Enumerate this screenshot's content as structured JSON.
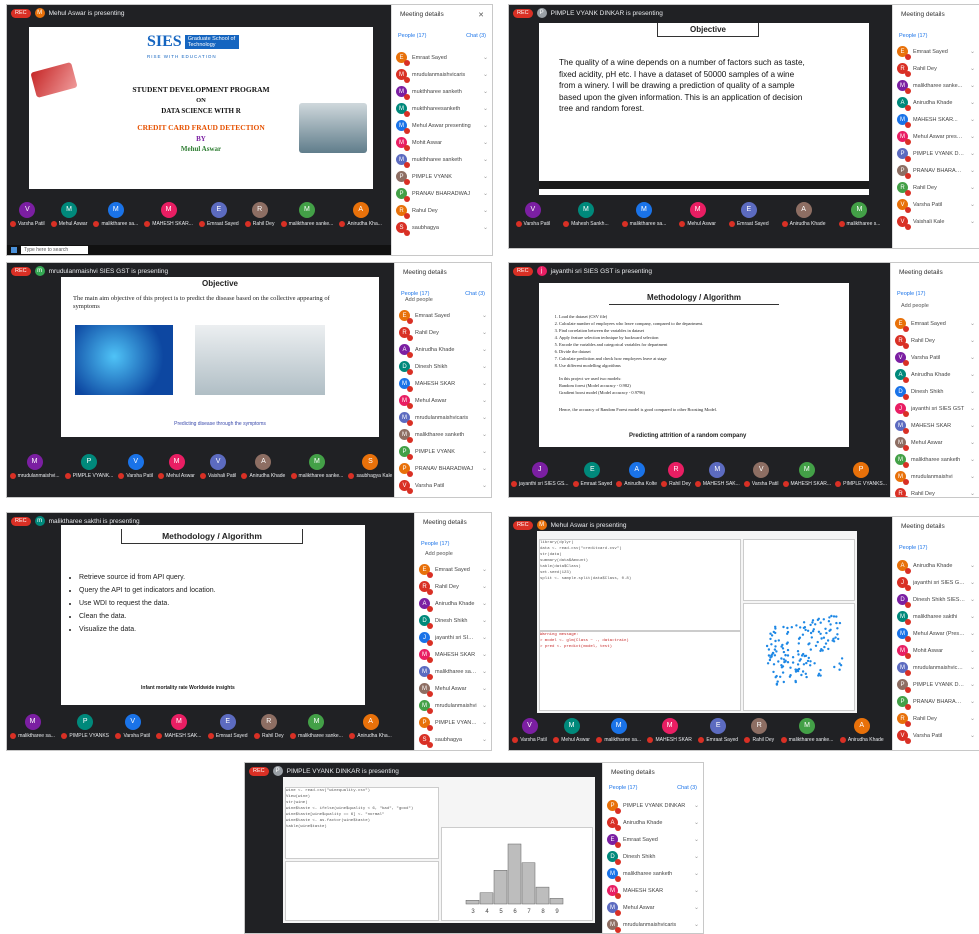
{
  "colors": {
    "meet_bg": "#202124",
    "accent": "#1a73e8",
    "mute": "#d93025",
    "rec": "#d93025"
  },
  "panel_common": {
    "title": "Meeting details",
    "people_tab": "People (17)",
    "chat_tab": "Chat (3)",
    "add_people": "Add people"
  },
  "shot1": {
    "presenter": "Mehul Aswar is presenting",
    "rec": "REC",
    "logo_text": "SIES",
    "logo_sub": "Graduate School of Technology",
    "logo_tagline": "RISE WITH EDUCATION",
    "line1": "STUDENT DEVELOPMENT PROGRAM",
    "line2": "ON",
    "line3": "DATA SCIENCE WITH R",
    "line4": "CREDIT CARD FRAUD DETECTION",
    "line5": "BY",
    "line6": "Mehul Aswar",
    "participants": [
      "Emraat Sayed",
      "mrudulanmaishvicaris",
      "mukthharee sanketh",
      "mukthhareesanketh",
      "Mehul Aswar presenting",
      "Mohit Aswar",
      "mukthharee sanketh",
      "PIMPLE VYANK",
      "PRANAV BHARADWAJ",
      "Rahul Dey",
      "saubhagya"
    ],
    "tiles": [
      "Varsha Patil",
      "Mehul Aswar",
      "maliktharee sa...",
      "MAHESH SKAR...",
      "Emraat Sayed",
      "Rahil Dey",
      "maliktharee sanke...",
      "Anirudha Kha..."
    ],
    "search": "Type here to search"
  },
  "shot2": {
    "presenter": "PIMPLE VYANK DINKAR is presenting",
    "slide_title": "Objective",
    "slide_body": "The quality of a wine depends on a number of factors such as taste, fixed acidity, pH etc. I have a dataset of 50000 samples of a wine from a winery. I will be drawing a prediction of quality of a sample based upon the given information. This is an application of decision tree and random forest.",
    "participants": [
      "Emraat Sayed",
      "Rahil Dey",
      "maliktharee sanke...",
      "Anirudha Khade",
      "MAHESH SKAR...",
      "Mehul Aswar presenting",
      "PIMPLE VYANK DINKAR",
      "PRANAV BHARADWAJ",
      "Rahil Dey",
      "Varsha Patil",
      "Vaishali Kale"
    ],
    "tiles": [
      "Varsha Patil",
      "Mahesh Sankh...",
      "maliktharee sa...",
      "Mehul Aswar",
      "Emraat Sayed",
      "Anirudha Khade",
      "maliktharee s..."
    ]
  },
  "shot3": {
    "presenter": "mrudulanmaishvi SIES GST is presenting",
    "slide_title": "Objective",
    "bullet": "The main aim objective of this project is to predict the disease based on the collective appearing of symptoms",
    "footer": "Predicting disease through the symptoms",
    "participants": [
      "Emraat Sayed",
      "Rahil Dey",
      "Anirudha Khade",
      "Dinesh Shikh",
      "MAHESH SKAR",
      "Mehul Aswar",
      "mrudulanmaishvicaris",
      "maliktharee sanketh",
      "PIMPLE VYANK",
      "PRANAV BHARADWAJ",
      "Varsha Patil"
    ],
    "tiles": [
      "mrudulanmaishvi...",
      "PIMPLE VYANK...",
      "Varsha Patil",
      "Mehul Aswar",
      "Vaishali Patil",
      "Anirudha Khade",
      "maliktharee sanke...",
      "saubhagya Kale"
    ]
  },
  "shot4": {
    "presenter": "jayanthi sri SIES GST is presenting",
    "slide_title": "Methodology / Algorithm",
    "steps": [
      "Load the dataset (CSV file)",
      "Calculate number of employees who leave company, compared to the department.",
      "Find correlation between the variables in dataset",
      "Apply feature selection technique by backward selection",
      "Encode the variables and categorical variables for department",
      "Divide the dataset",
      "Calculate prediction and check how employees leave at stage",
      "Use different modelling algorithms"
    ],
    "conclusion_lines": [
      "In this project we used two models:",
      "Random forest (Model accuracy - 0.982)",
      "Gradient boost model (Model accuracy - 0.9796)"
    ],
    "final": "Hence, the accuracy of Random Forest model is good compared to other Boosting Model.",
    "footer": "Predicting attrition of a random company",
    "participants": [
      "Emraat Sayed",
      "Rahil Dey",
      "Varsha Patil",
      "Anirudha Khade",
      "Dinesh Shikh",
      "jayanthi sri SIES GST",
      "MAHESH SKAR",
      "Mehul Aswar",
      "maliktharee sanketh",
      "mrudulanmaishvi",
      "Rahil Dey"
    ],
    "tiles": [
      "jayanthi sri SIES GS...",
      "Emraat Sayed",
      "Anirudha Kolte",
      "Rahil Dey",
      "MAHESH SAK...",
      "Varsha Patil",
      "MAHESH SKAR...",
      "PIMPLE VYANKS..."
    ]
  },
  "shot5": {
    "presenter": "maliktharee sakthi is presenting",
    "slide_title": "Methodology / Algorithm",
    "bullets": [
      "Retrieve source id from API query.",
      "Query the API to get indicators and location.",
      "Use WDI to request the data.",
      "Clean the data.",
      "Visualize the data."
    ],
    "footer": "Infant mortality rate Worldwide insights",
    "participants": [
      "Emraat Sayed",
      "Rahil Dey",
      "Anirudha Khade",
      "Dinesh Shikh",
      "jayanthi sri SIES GST",
      "MAHESH SKAR",
      "maliktharee sakthi",
      "Mehul Aswar",
      "mrudulanmaishvi",
      "PIMPLE VYANKS",
      "saubhagya"
    ],
    "tiles": [
      "maliktharee sa...",
      "PIMPLE VYANKS",
      "Varsha Patil",
      "MAHESH SAK...",
      "Emraat Sayed",
      "Rahil Dey",
      "maliktharee sanke...",
      "Anirudha Kha..."
    ]
  },
  "shot6": {
    "presenter": "Mehul Aswar is presenting",
    "participants": [
      "Anirudha Khade",
      "jayanthi sri SIES GST",
      "Dinesh Shikh SIES GST",
      "maliktharee sakthi",
      "Mehul Aswar (Presenting)",
      "Mohit Aswar",
      "mrudulanmaishvicaris",
      "PIMPLE VYANK DINKAR",
      "PRANAV BHARADWAJ",
      "Rahil Dey",
      "Varsha Patil"
    ],
    "tiles": [
      "Varsha Patil",
      "Mehul Aswar",
      "maliktharee sa...",
      "MAHESH SKAR",
      "Emraat Sayed",
      "Rahil Dey",
      "maliktharee sanke...",
      "Anirudha Khade"
    ]
  },
  "shot7": {
    "presenter": "PIMPLE VYANK DINKAR is presenting",
    "histogram_values": [
      2,
      6,
      18,
      32,
      22,
      9,
      3
    ],
    "histogram_ticks": [
      "3",
      "4",
      "5",
      "6",
      "7",
      "8",
      "9"
    ],
    "participants": [
      "PIMPLE VYANK DINKAR",
      "Anirudha Khade",
      "Emraat Sayed",
      "Dinesh Shikh",
      "maliktharee sanketh",
      "MAHESH SKAR",
      "Mehul Aswar",
      "mrudulanmaishvicaris",
      "PRANAV BHARADWAJ",
      "Rahil Dey"
    ]
  }
}
